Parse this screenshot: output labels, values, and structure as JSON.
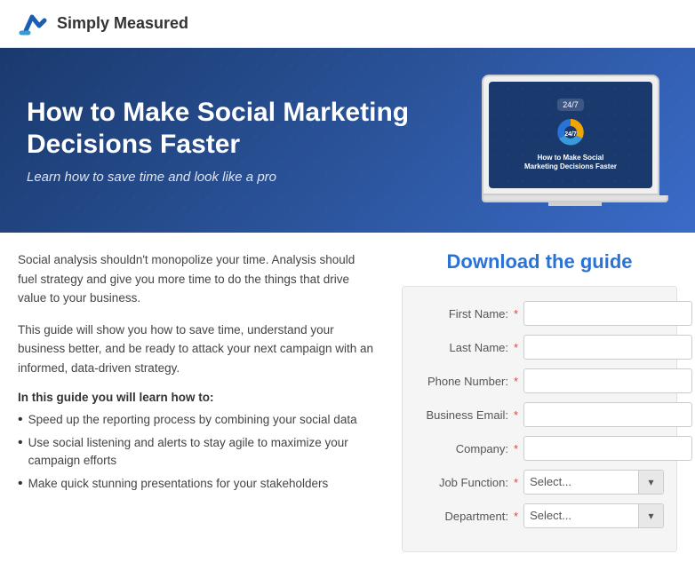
{
  "header": {
    "logo_text": "Simply Measured",
    "logo_alt": "Simply Measured logo"
  },
  "hero": {
    "title": "How to Make Social Marketing Decisions Faster",
    "subtitle": "Learn how to save time and look like a pro",
    "laptop_screen_badge": "24/7",
    "laptop_screen_title_line1": "How to Make Social",
    "laptop_screen_title_line2": "Marketing Decisions Faster"
  },
  "left": {
    "paragraph1": "Social analysis shouldn't monopolize your time. Analysis should fuel strategy and give you more time to do the things that drive value to your business.",
    "paragraph2": "This guide will show you how to save time, understand your business better, and be ready to attack your next campaign with an informed, data-driven strategy.",
    "learn_heading": "In this guide you will learn how to:",
    "bullets": [
      "Speed up the reporting process by combining your social data",
      "Use social listening and alerts to stay agile to maximize your campaign efforts",
      "Make quick stunning presentations for your stakeholders"
    ]
  },
  "form": {
    "title": "Download the guide",
    "fields": [
      {
        "label": "First Name:",
        "type": "input",
        "required": true,
        "name": "first-name"
      },
      {
        "label": "Last Name:",
        "type": "input",
        "required": true,
        "name": "last-name"
      },
      {
        "label": "Phone Number:",
        "type": "input",
        "required": true,
        "name": "phone-number"
      },
      {
        "label": "Business Email:",
        "type": "input",
        "required": true,
        "name": "business-email"
      },
      {
        "label": "Company:",
        "type": "input",
        "required": true,
        "name": "company"
      },
      {
        "label": "Job Function:",
        "type": "select",
        "required": true,
        "name": "job-function",
        "placeholder": "Select..."
      },
      {
        "label": "Department:",
        "type": "select",
        "required": true,
        "name": "department",
        "placeholder": "Select..."
      }
    ]
  },
  "icons": {
    "chevron_down": "▾",
    "bullet": "•"
  }
}
